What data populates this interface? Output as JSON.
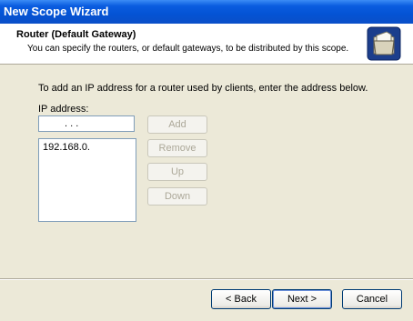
{
  "window": {
    "title": "New Scope Wizard"
  },
  "header": {
    "title": "Router (Default Gateway)",
    "subtitle": "You can specify the routers, or default gateways, to be distributed by this scope.",
    "icon": "folder-wizard-icon"
  },
  "main": {
    "instruction": "To add an IP address for a router used by clients, enter the address below.",
    "ip_label": "IP address:",
    "ip_value": ". . .",
    "routers": [
      "192.168.0."
    ],
    "buttons": {
      "add": "Add",
      "remove": "Remove",
      "up": "Up",
      "down": "Down"
    }
  },
  "footer": {
    "back": "< Back",
    "next": "Next >",
    "cancel": "Cancel"
  }
}
